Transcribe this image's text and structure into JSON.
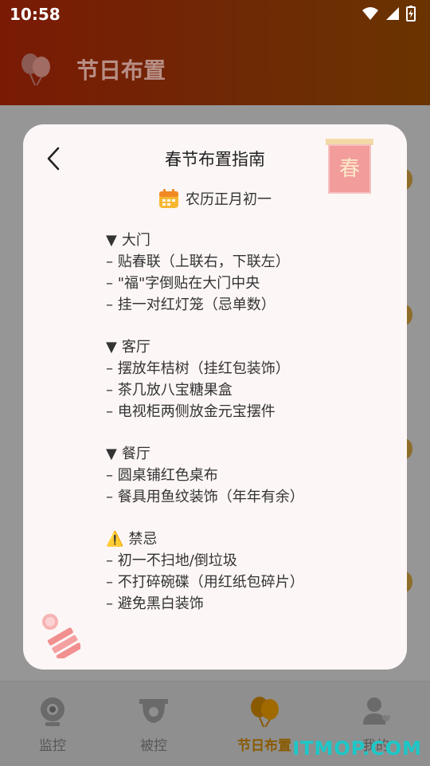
{
  "status": {
    "time": "10:58"
  },
  "app": {
    "title": "节日布置"
  },
  "modal": {
    "title": "春节布置指南",
    "date": "农历正月初一",
    "scroll_char": "春",
    "sections": [
      {
        "marker": "▼",
        "heading": "大门",
        "items": [
          "– 贴春联（上联右，下联左）",
          "– \"福\"字倒贴在大门中央",
          "– 挂一对红灯笼（忌单数）"
        ]
      },
      {
        "marker": "▼",
        "heading": "客厅",
        "items": [
          "– 摆放年桔树（挂红包装饰）",
          "– 茶几放八宝糖果盒",
          "– 电视柜两侧放金元宝摆件"
        ]
      },
      {
        "marker": "▼",
        "heading": "餐厅",
        "items": [
          "– 圆桌铺红色桌布",
          "– 餐具用鱼纹装饰（年年有余）"
        ]
      },
      {
        "marker": "⚠️",
        "heading": "禁忌",
        "items": [
          "– 初一不扫地/倒垃圾",
          "– 不打碎碗碟（用红纸包碎片）",
          "– 避免黑白装饰"
        ]
      }
    ]
  },
  "nav": {
    "items": [
      {
        "label": "监控",
        "icon": "camera-icon"
      },
      {
        "label": "被控",
        "icon": "security-camera-icon"
      },
      {
        "label": "节日布置",
        "icon": "balloon-icon"
      },
      {
        "label": "我的",
        "icon": "user-icon"
      }
    ],
    "active_index": 2
  },
  "watermark": "ITMOP.COM",
  "colors": {
    "accent": "#8a5a00",
    "header": "#7a1a05",
    "modal_bg": "#fdf6f6"
  }
}
